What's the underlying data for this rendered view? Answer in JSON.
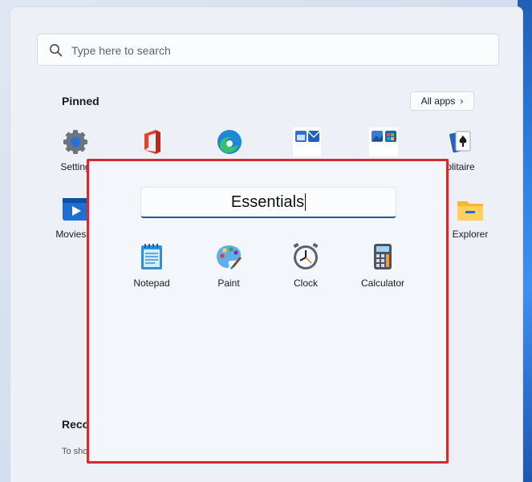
{
  "search": {
    "placeholder": "Type here to search"
  },
  "pinned": {
    "title": "Pinned",
    "all_apps_label": "All apps",
    "tiles": [
      {
        "label": "Setting",
        "icon": "settings-icon"
      },
      {
        "label": "",
        "icon": "office-icon"
      },
      {
        "label": "",
        "icon": "edge-icon"
      },
      {
        "label": "",
        "icon": "calendar-mail-icon"
      },
      {
        "label": "",
        "icon": "photos-store-icon"
      },
      {
        "label": "olitaire",
        "icon": "solitaire-icon"
      },
      {
        "label": "Movies &",
        "icon": "movies-tv-icon"
      },
      {
        "label": "Explorer",
        "icon": "file-explorer-icon"
      }
    ]
  },
  "folder": {
    "name": "Essentials",
    "apps": [
      {
        "label": "Notepad",
        "icon": "notepad-icon"
      },
      {
        "label": "Paint",
        "icon": "paint-icon"
      },
      {
        "label": "Clock",
        "icon": "clock-icon"
      },
      {
        "label": "Calculator",
        "icon": "calculator-icon"
      }
    ]
  },
  "recommended": {
    "title": "Reco",
    "text": "To sho"
  },
  "colors": {
    "highlight_border": "#d42a32",
    "accent": "#1f5a92"
  }
}
